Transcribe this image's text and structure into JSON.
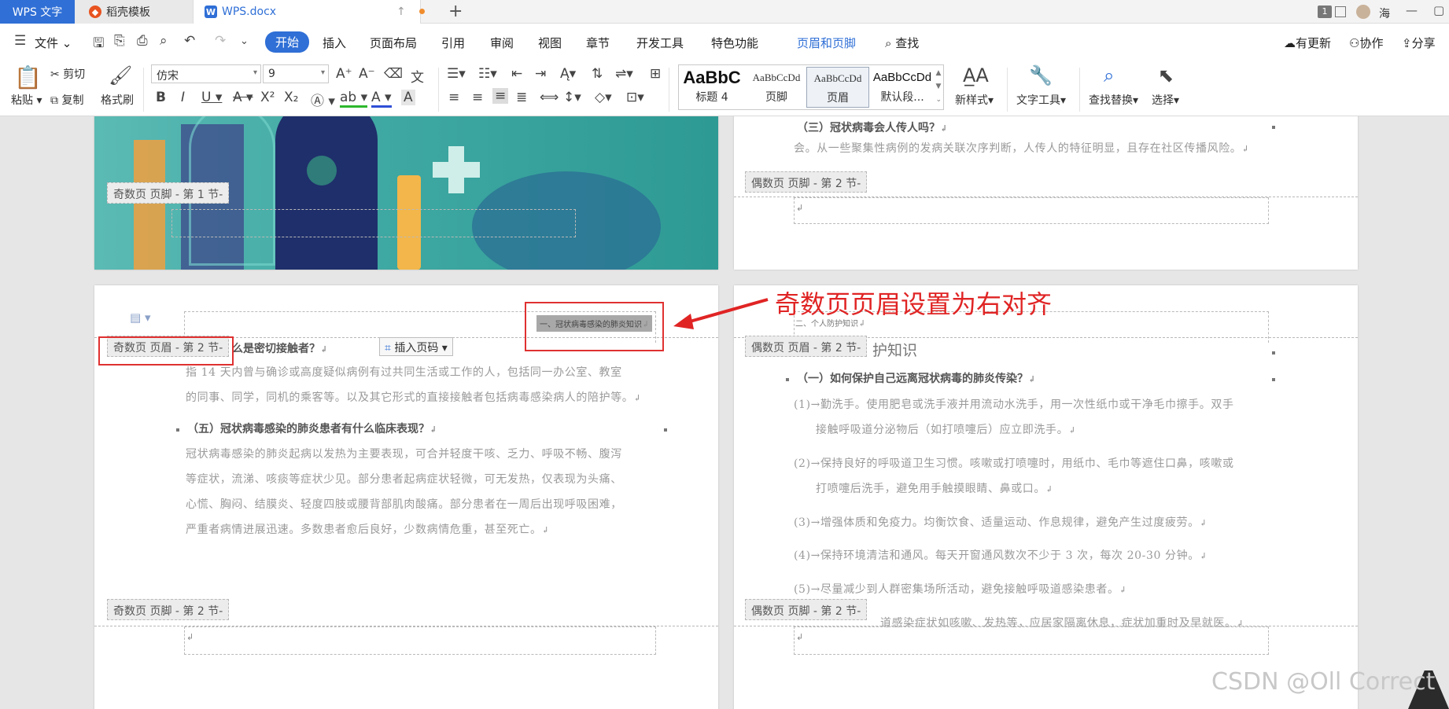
{
  "titlebar": {
    "tabs": [
      {
        "label": "WPS 文字"
      },
      {
        "label": "稻壳模板"
      },
      {
        "label": "WPS.docx"
      }
    ],
    "window_badge": "1",
    "user": "海"
  },
  "menubar": {
    "file": "文件",
    "items": [
      "开始",
      "插入",
      "页面布局",
      "引用",
      "审阅",
      "视图",
      "章节",
      "开发工具",
      "特色功能"
    ],
    "active": "开始",
    "context_tab": "页眉和页脚",
    "search": "查找",
    "right": [
      "有更新",
      "协作",
      "分享"
    ]
  },
  "ribbon": {
    "paste": "粘贴",
    "cut": "剪切",
    "copy": "复制",
    "format_painter": "格式刷",
    "font_name": "仿宋",
    "font_size": "9",
    "styles": [
      {
        "preview": "AaBbC",
        "name": "标题 4"
      },
      {
        "preview": "AaBbCcDd",
        "name": "页脚"
      },
      {
        "preview": "AaBbCcDd",
        "name": "页眉"
      },
      {
        "preview": "AaBbCcDd",
        "name": "默认段..."
      }
    ],
    "new_style": "新样式",
    "text_tools": "文字工具",
    "find_replace": "查找替换",
    "select": "选择"
  },
  "doc": {
    "p1_footer_label": "奇数页 页脚 - 第 1 节-",
    "p2_heading": "（三）冠状病毒会人传人吗？",
    "p2_text": "会。从一些聚集性病例的发病关联次序判断，人传人的特征明显，且存在社区传播风险。",
    "p2_footer_label": "偶数页 页脚 - 第 2 节-",
    "p3_header_label": "奇数页 页眉 - 第 2 节-",
    "p3_header_text": "一、冠状病毒感染的肺炎知识",
    "insert_page_number": "插入页码",
    "p3_heading1": "么是密切接触者？",
    "p3_para1": [
      "指 14 天内曾与确诊或高度疑似病例有过共同生活或工作的人，包括同一办公室、教室",
      "的同事、同学，同机的乘客等。以及其它形式的直接接触者包括病毒感染病人的陪护等。"
    ],
    "p3_heading2": "（五）冠状病毒感染的肺炎患者有什么临床表现？",
    "p3_para2": [
      "冠状病毒感染的肺炎起病以发热为主要表现，可合并轻度干咳、乏力、呼吸不畅、腹泻",
      "等症状，流涕、咳痰等症状少见。部分患者起病症状轻微，可无发热，仅表现为头痛、",
      "心慌、胸闷、结膜炎、轻度四肢或腰背部肌肉酸痛。部分患者在一周后出现呼吸困难，",
      "严重者病情进展迅速。多数患者愈后良好，少数病情危重，甚至死亡。"
    ],
    "p3_footer_label": "奇数页 页脚 - 第 2 节-",
    "p4_header_label": "偶数页 页眉 - 第 2 节-",
    "p4_header_text": "二、个人防护知识",
    "p4_title": "护知识",
    "p4_heading": "（一）如何保护自己远离冠状病毒的肺炎传染？",
    "p4_items": [
      [
        "(1)→勤洗手。使用肥皂或洗手液并用流动水洗手，用一次性纸巾或干净毛巾擦手。双手",
        "接触呼吸道分泌物后（如打喷嚏后）应立即洗手。"
      ],
      [
        "(2)→保持良好的呼吸道卫生习惯。咳嗽或打喷嚏时，用纸巾、毛巾等遮住口鼻，咳嗽或",
        "打喷嚏后洗手，避免用手触摸眼睛、鼻或口。"
      ],
      [
        "(3)→增强体质和免疫力。均衡饮食、适量运动、作息规律，避免产生过度疲劳。"
      ],
      [
        "(4)→保持环境清洁和通风。每天开窗通风数次不少于 3 次，每次 20-30 分钟。"
      ],
      [
        "(5)→尽量减少到人群密集场所活动，避免接触呼吸道感染患者。"
      ]
    ],
    "p4_last_line": "道感染症状如咳嗽、发热等，应居家隔离休息，症状加重时及早就医。",
    "p4_footer_label": "偶数页 页脚 - 第 2 节-"
  },
  "annotation": "奇数页页眉设置为右对齐",
  "watermark": "CSDN @Oll Correct"
}
